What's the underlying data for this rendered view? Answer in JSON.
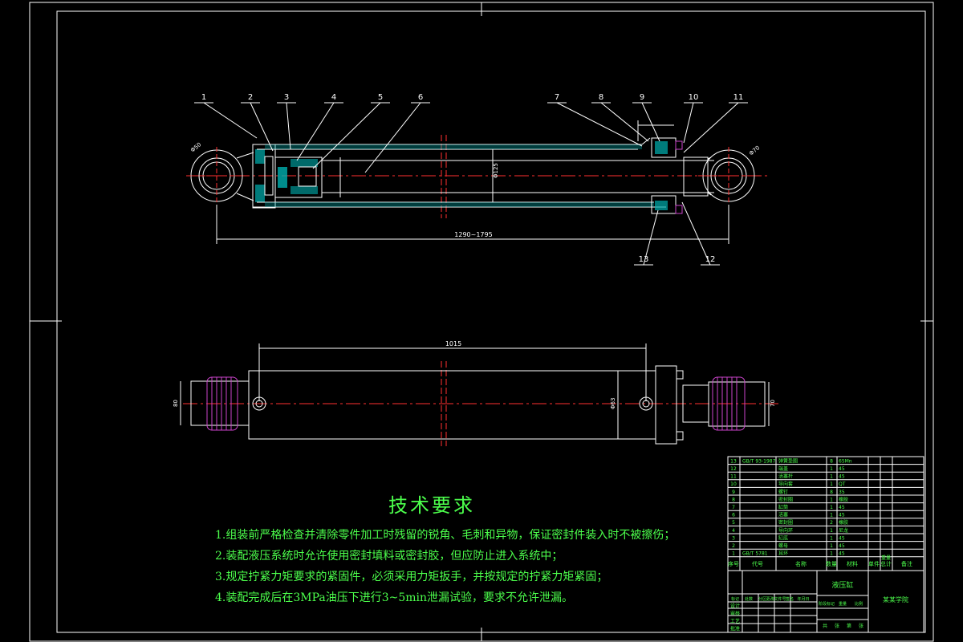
{
  "drawing": {
    "colors": {
      "background": "#000000",
      "frame": "#ffffff",
      "outline": "#ffffff",
      "centerline": "#ff3030",
      "section_fill": "#00b0b0",
      "seal": "#cc44cc",
      "text": "#4cff4c",
      "leader": "#ffffff",
      "table_line": "#ffffff"
    },
    "balloons": [
      "1",
      "2",
      "3",
      "4",
      "5",
      "6",
      "7",
      "8",
      "9",
      "10",
      "11",
      "12",
      "13"
    ],
    "dimensions": {
      "overall_length": "1290~1795",
      "bottom_length": "1015",
      "bore_diameter": "Φ125",
      "rod_diameter": "Φ70",
      "pin_diameter": "Φ50",
      "end_height": "Φ63",
      "left_height": "80",
      "right_height": "70"
    },
    "tech_requirements": {
      "title": "技术要求",
      "items": [
        "1.组装前严格检查并清除零件加工时残留的锐角、毛刺和异物，保证密封件装入时不被擦伤；",
        "2.装配液压系统时允许使用密封填料或密封胶，但应防止进入系统中；",
        "3.规定拧紧力矩要求的紧固件，必须采用力矩扳手，并按规定的拧紧力矩紧固；",
        "4.装配完成后在3MPa油压下进行3~5min泄漏试验，要求不允许泄漏。"
      ]
    },
    "parts_table": {
      "headers": [
        "序号",
        "代号",
        "名称",
        "数量",
        "材料",
        "单件",
        "总计",
        "备注"
      ],
      "sub_header_mass": "重量",
      "rows": [
        {
          "no": "13",
          "code": "GB/T 93-1987",
          "name": "弹簧垫圈",
          "qty": "8",
          "mat": "65Mn"
        },
        {
          "no": "12",
          "code": "",
          "name": "端盖",
          "qty": "1",
          "mat": "45"
        },
        {
          "no": "11",
          "code": "",
          "name": "活塞杆",
          "qty": "1",
          "mat": "45"
        },
        {
          "no": "10",
          "code": "",
          "name": "导向套",
          "qty": "1",
          "mat": "QT"
        },
        {
          "no": "9",
          "code": "",
          "name": "螺钉",
          "qty": "8",
          "mat": "35"
        },
        {
          "no": "8",
          "code": "",
          "name": "密封圈",
          "qty": "1",
          "mat": "橡胶"
        },
        {
          "no": "7",
          "code": "",
          "name": "缸筒",
          "qty": "1",
          "mat": "45"
        },
        {
          "no": "6",
          "code": "",
          "name": "活塞",
          "qty": "1",
          "mat": "45"
        },
        {
          "no": "5",
          "code": "",
          "name": "密封圈",
          "qty": "2",
          "mat": "橡胶"
        },
        {
          "no": "4",
          "code": "",
          "name": "导向环",
          "qty": "1",
          "mat": "尼龙"
        },
        {
          "no": "3",
          "code": "",
          "name": "缸底",
          "qty": "1",
          "mat": "45"
        },
        {
          "no": "2",
          "code": "",
          "name": "螺母",
          "qty": "1",
          "mat": "45"
        },
        {
          "no": "1",
          "code": "GB/T 5781",
          "name": "耳环",
          "qty": "1",
          "mat": "45"
        }
      ]
    },
    "title_block": {
      "drawing_name": "液压缸",
      "school": "某某学院",
      "roles": [
        "设计",
        "审核",
        "工艺",
        "批准"
      ],
      "stage_labels": [
        "阶段标记",
        "重量",
        "比例"
      ],
      "sheet": [
        "共",
        "张",
        "第",
        "张"
      ],
      "revision_labels": [
        "标记",
        "处数",
        "分区",
        "更改文件号",
        "签名",
        "年月日"
      ]
    }
  }
}
